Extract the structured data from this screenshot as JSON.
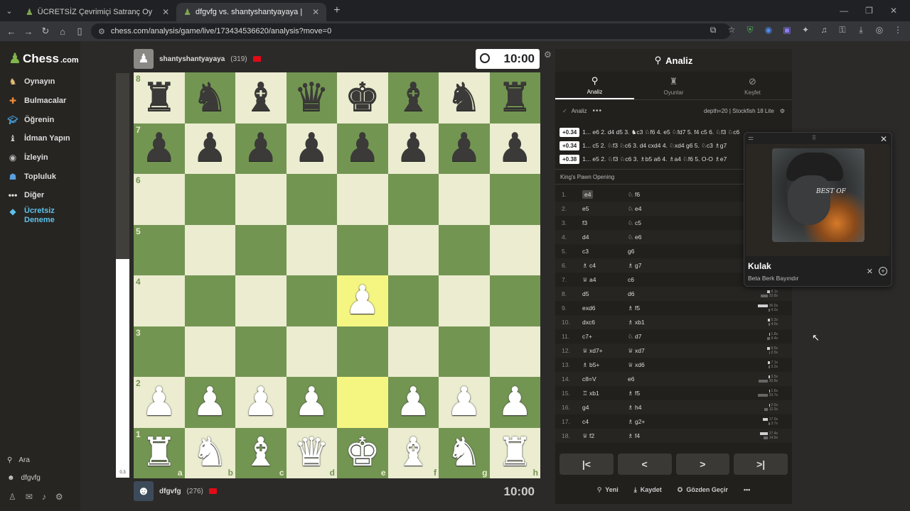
{
  "browser": {
    "tabs": [
      {
        "title": "ÜCRETSİZ Çevrimiçi Satranç Oy",
        "active": false
      },
      {
        "title": "dfgvfg vs. shantyshantyayaya |",
        "active": true
      }
    ],
    "url": "chess.com/analysis/game/live/173434536620/analysis?move=0"
  },
  "sidebar": {
    "logo_main": "Chess",
    "logo_suffix": ".com",
    "items": [
      {
        "label": "Oynayın",
        "icon": "play-icon"
      },
      {
        "label": "Bulmacalar",
        "icon": "puzzle-icon"
      },
      {
        "label": "Öğrenin",
        "icon": "learn-icon"
      },
      {
        "label": "İdman Yapın",
        "icon": "train-icon"
      },
      {
        "label": "İzleyin",
        "icon": "watch-icon"
      },
      {
        "label": "Topluluk",
        "icon": "community-icon"
      },
      {
        "label": "Diğer",
        "icon": "more-icon"
      }
    ],
    "trial_line1": "Ücretsiz",
    "trial_line2": "Deneme",
    "search": "Ara",
    "username": "dfgvfg"
  },
  "top_player": {
    "name": "shantyshantyayaya",
    "rating": "(319)",
    "clock": "10:00"
  },
  "bottom_player": {
    "name": "dfgvfg",
    "rating": "(276)",
    "clock": "10:00"
  },
  "eval": {
    "label": "0.3",
    "white_fraction": 0.54
  },
  "board": {
    "rows": [
      [
        "br",
        "bn",
        "bb",
        "bq",
        "bk",
        "bb",
        "bn",
        "br"
      ],
      [
        "bp",
        "bp",
        "bp",
        "bp",
        "bp",
        "bp",
        "bp",
        "bp"
      ],
      [
        "",
        "",
        "",
        "",
        "",
        "",
        "",
        ""
      ],
      [
        "",
        "",
        "",
        "",
        "",
        "",
        "",
        ""
      ],
      [
        "",
        "",
        "",
        "",
        "wp",
        "",
        "",
        ""
      ],
      [
        "",
        "",
        "",
        "",
        "",
        "",
        "",
        ""
      ],
      [
        "wp",
        "wp",
        "wp",
        "wp",
        "",
        "wp",
        "wp",
        "wp"
      ],
      [
        "wr",
        "wn",
        "wb",
        "wq",
        "wk",
        "wb",
        "wn",
        "wr"
      ]
    ],
    "highlights": [
      "e4",
      "e2"
    ],
    "ranks": [
      "8",
      "7",
      "6",
      "5",
      "4",
      "3",
      "2",
      "1"
    ],
    "files": [
      "a",
      "b",
      "c",
      "d",
      "e",
      "f",
      "g",
      "h"
    ]
  },
  "panel": {
    "title": "Analiz",
    "tabs": [
      "Analiz",
      "Oyunlar",
      "Keşfet"
    ],
    "engine_label": "Analiz",
    "depth": "depth=20 | Stockfish 18 Lite",
    "lines": [
      {
        "score": "+0.34",
        "text": "1... e6 2. d4 d5 3. ♞c3 ♘f6 4. e5 ♘fd7 5. f4 c5 6. ♘f3 ♘c6"
      },
      {
        "score": "+0.34",
        "text": "1... c5 2. ♘f3 ♘c6 3. d4 cxd4 4. ♘xd4 g6 5. ♘c3 ♗g7"
      },
      {
        "score": "+0.38",
        "text": "1... e5 2. ♘f3 ♘c6 3. ♗b5 a6 4. ♗a4 ♘f6 5. O-O ♗e7"
      }
    ],
    "opening": "King's Pawn Opening",
    "moves": [
      {
        "n": "1.",
        "w": "e4",
        "b": "♘ f6"
      },
      {
        "n": "2.",
        "w": "e5",
        "b": "♘ e4"
      },
      {
        "n": "3.",
        "w": "f3",
        "b": "♘ c5"
      },
      {
        "n": "4.",
        "w": "d4",
        "b": "♘ e6"
      },
      {
        "n": "5.",
        "w": "c3",
        "b": "g6"
      },
      {
        "n": "6.",
        "w": "♗ c4",
        "b": "♗ g7"
      },
      {
        "n": "7.",
        "w": "♕ a4",
        "b": "c6"
      },
      {
        "n": "8.",
        "w": "d5",
        "b": "d6"
      },
      {
        "n": "9.",
        "w": "exd6",
        "b": "♗ f5"
      },
      {
        "n": "10.",
        "w": "dxc6",
        "b": "♗ xb1"
      },
      {
        "n": "11.",
        "w": "c7+",
        "b": "♘ d7"
      },
      {
        "n": "12.",
        "w": "♕ xd7+",
        "b": "♕ xd7"
      },
      {
        "n": "13.",
        "w": "♗ b5+",
        "b": "♕ xd6"
      },
      {
        "n": "14.",
        "w": "c8=V",
        "b": "e6"
      },
      {
        "n": "15.",
        "w": "♖ xb1",
        "b": "♗ f5"
      },
      {
        "n": "16.",
        "w": "g4",
        "b": "♗ h4"
      },
      {
        "n": "17.",
        "w": "c4",
        "b": "♗ g2+"
      },
      {
        "n": "18.",
        "w": "♕ f2",
        "b": "♗ f4"
      }
    ],
    "times": [
      [
        "",
        ""
      ],
      [
        "",
        ""
      ],
      [
        "",
        ""
      ],
      [
        "",
        ""
      ],
      [
        "",
        ""
      ],
      [
        "",
        ""
      ],
      [
        "",
        ""
      ],
      [
        "8.1s",
        "23.8s"
      ],
      [
        "36.0s",
        "4.2s"
      ],
      [
        "5.2s",
        "4.0s"
      ],
      [
        "1.8s",
        "9.4s"
      ],
      [
        "8.5s",
        "2.5s"
      ],
      [
        "7.1s",
        "3.2s"
      ],
      [
        "3.5s",
        "30.8s"
      ],
      [
        "1.6s",
        "33.7s"
      ],
      [
        "2.5s",
        "12.3s"
      ],
      [
        "17.0s",
        "3.7s"
      ],
      [
        "27.4s",
        "14.9s"
      ]
    ],
    "actions": [
      "Yeni",
      "Kaydet",
      "Gözden Geçir"
    ]
  },
  "media": {
    "title": "Kulak",
    "artist": "Beta Berk Bayındır",
    "art_text": "BEST OF"
  }
}
